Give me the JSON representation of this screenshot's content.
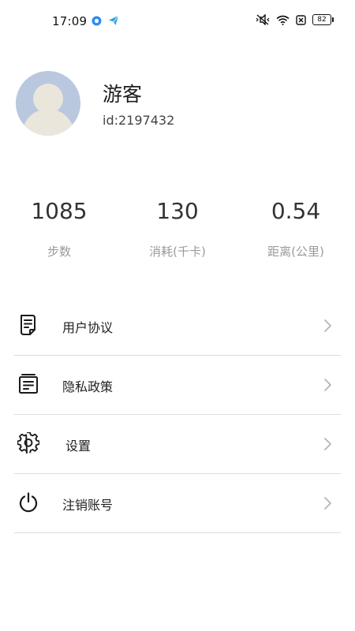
{
  "status_bar": {
    "time": "17:09",
    "battery": "82"
  },
  "profile": {
    "name": "游客",
    "id": "id:2197432"
  },
  "stats": [
    {
      "value": "1085",
      "label": "步数"
    },
    {
      "value": "130",
      "label": "消耗(千卡)"
    },
    {
      "value": "0.54",
      "label": "距离(公里)"
    }
  ],
  "menu": [
    {
      "label": "用户协议",
      "icon": "document-icon"
    },
    {
      "label": "隐私政策",
      "icon": "notebook-icon"
    },
    {
      "label": "设置",
      "icon": "gear-icon"
    },
    {
      "label": "注销账号",
      "icon": "power-icon"
    }
  ],
  "colors": {
    "avatar_bg": "#b9c8de",
    "avatar_figure": "#ebe6dc",
    "divider": "#dcdcdc",
    "muted_text": "#9a9a9a"
  }
}
